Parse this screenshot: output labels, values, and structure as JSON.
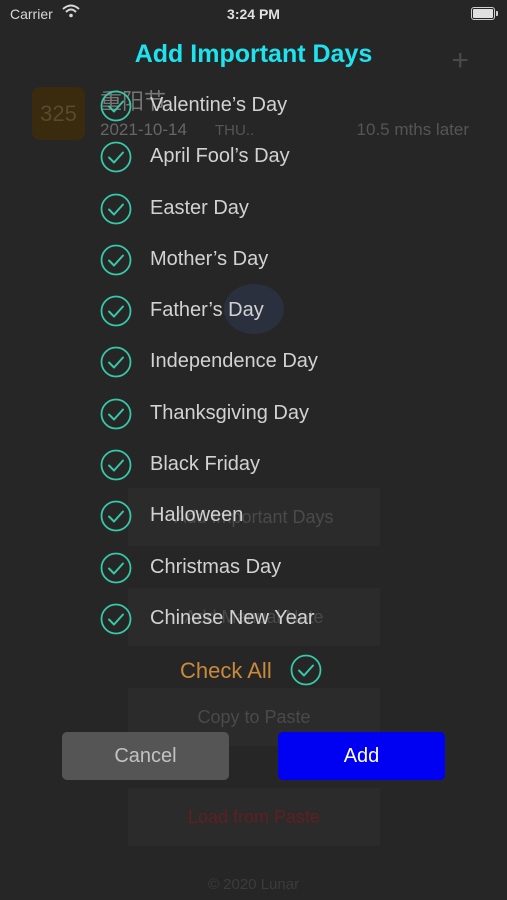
{
  "status_bar": {
    "carrier": "Carrier",
    "time": "3:24 PM"
  },
  "background": {
    "add_icon": "plus-icon",
    "event": {
      "badge_number": "325",
      "title": "重阳节",
      "date": "2021-10-14",
      "weekday": "THU..",
      "countdown": "10.5 mths later"
    },
    "menu": {
      "important_days_label": "Add Important Days",
      "manual_label": "Add Manual Note",
      "copy_label": "Copy to Paste",
      "load_label": "Load from Paste"
    },
    "footer_text": "© 2020 Lunar"
  },
  "dialog": {
    "title": "Add Important Days",
    "items": [
      {
        "label": "Valentine’s Day",
        "checked": true
      },
      {
        "label": "April Fool’s Day",
        "checked": true
      },
      {
        "label": "Easter Day",
        "checked": true
      },
      {
        "label": "Mother’s Day",
        "checked": true
      },
      {
        "label": "Father’s Day",
        "checked": true
      },
      {
        "label": "Independence Day",
        "checked": true
      },
      {
        "label": "Thanksgiving Day",
        "checked": true
      },
      {
        "label": "Black Friday",
        "checked": true
      },
      {
        "label": "Halloween",
        "checked": true
      },
      {
        "label": "Christmas Day",
        "checked": true
      },
      {
        "label": "Chinese New Year",
        "checked": true
      }
    ],
    "check_all_label": "Check All",
    "check_all_checked": true,
    "cancel_label": "Cancel",
    "add_label": "Add"
  },
  "colors": {
    "title": "#1ee3ef",
    "check": "#35c9a9",
    "check_all_text": "#c98a3c",
    "add_button": "#0000f2",
    "cancel_button": "#555555"
  }
}
